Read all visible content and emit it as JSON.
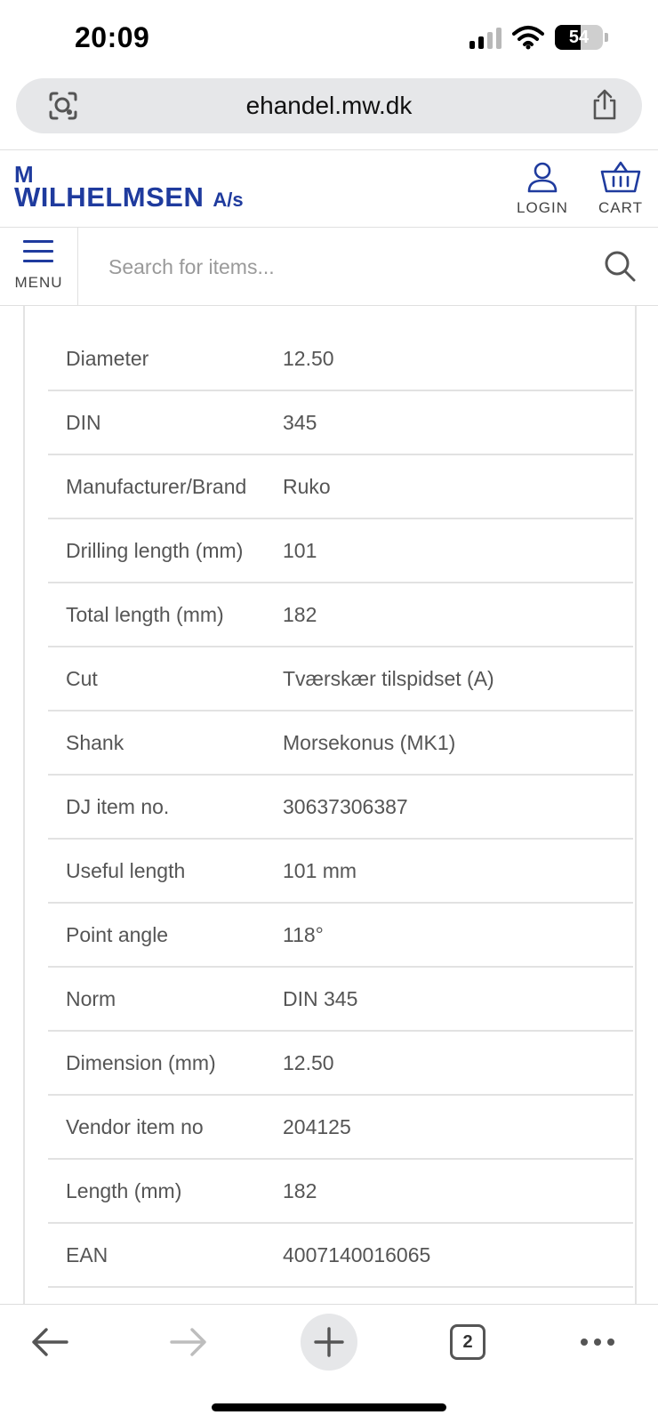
{
  "status_bar": {
    "time": "20:09",
    "battery_percent": "54"
  },
  "browser": {
    "url": "ehandel.mw.dk",
    "open_tabs": "2"
  },
  "header": {
    "logo_mw": "M",
    "logo_name": "WILHELMSEN",
    "logo_suffix": "A/s",
    "login_label": "LOGIN",
    "cart_label": "CART",
    "menu_label": "MENU",
    "search_placeholder": "Search for items..."
  },
  "specs": [
    {
      "label": "Diameter",
      "value": "12.50"
    },
    {
      "label": "DIN",
      "value": "345"
    },
    {
      "label": "Manufacturer/Brand",
      "value": "Ruko"
    },
    {
      "label": "Drilling length (mm)",
      "value": "101"
    },
    {
      "label": "Total length (mm)",
      "value": "182"
    },
    {
      "label": "Cut",
      "value": "Tværskær tilspidset (A)"
    },
    {
      "label": "Shank",
      "value": "Morsekonus (MK1)"
    },
    {
      "label": "DJ item no.",
      "value": "30637306387"
    },
    {
      "label": "Useful length",
      "value": "101 mm"
    },
    {
      "label": "Point angle",
      "value": "118°"
    },
    {
      "label": "Norm",
      "value": "DIN 345"
    },
    {
      "label": "Dimension (mm)",
      "value": "12.50"
    },
    {
      "label": "Vendor item no",
      "value": "204125"
    },
    {
      "label": "Length (mm)",
      "value": "182"
    },
    {
      "label": "EAN",
      "value": "4007140016065"
    }
  ],
  "colors": {
    "brand": "#1f3b9e",
    "url_bar": "#e6e7e9",
    "divider": "#e2e2e2"
  },
  "icons": {
    "lens": "visual-lookup-icon",
    "share": "share-icon",
    "login": "user-icon",
    "cart": "basket-icon",
    "menu": "hamburger-icon",
    "search": "search-icon",
    "back": "arrow-left-icon",
    "forward": "arrow-right-icon",
    "new_tab": "plus-icon",
    "tabs": "tabs-icon",
    "more": "more-icon"
  }
}
